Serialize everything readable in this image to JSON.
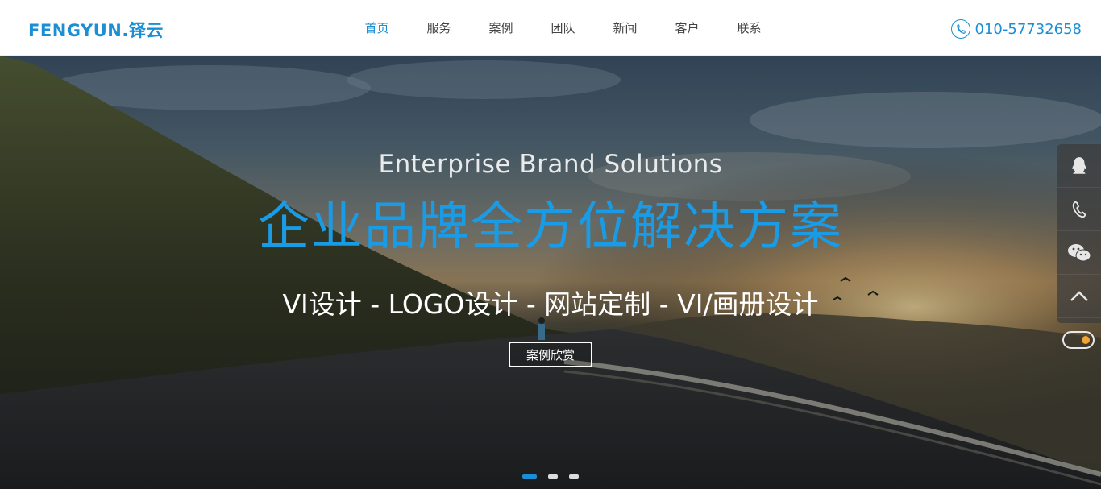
{
  "header": {
    "logo_text": "FENGYUN.铎云",
    "nav": [
      "首页",
      "服务",
      "案例",
      "团队",
      "新闻",
      "客户",
      "联系"
    ],
    "active_nav": "首页",
    "phone": "010-57732658",
    "accent_color": "#1a8fd6"
  },
  "hero": {
    "subtitle_en": "Enterprise Brand Solutions",
    "headline": "企业品牌全方位解决方案",
    "services_line": "VI设计 - LOGO设计 - 网站定制 - VI/画册设计",
    "cta_label": "案例欣赏",
    "slides_total": 3,
    "active_slide": 1
  },
  "sidebar": {
    "icons": [
      "qq-icon",
      "phone-icon",
      "wechat-icon",
      "back-to-top-icon"
    ]
  }
}
